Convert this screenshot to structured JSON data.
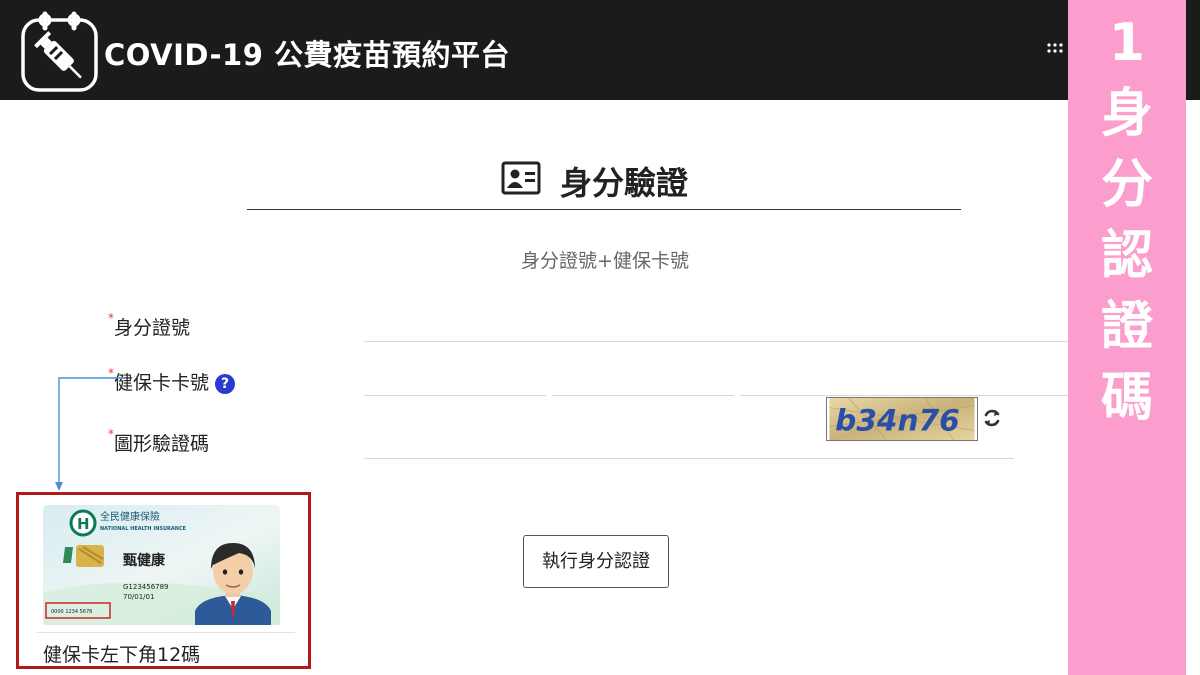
{
  "app": {
    "title": "COVID-19 公費疫苗預約平台",
    "logo_icon": "vaccine-syringe-icon",
    "menu_icon": "grid-dots-icon"
  },
  "banner": {
    "step_number": "1",
    "chars": [
      "身",
      "分",
      "認",
      "證",
      "碼"
    ],
    "color": "#fb9dcd"
  },
  "page": {
    "title": "身分驗證",
    "title_icon": "id-card-icon",
    "subtitle": "身分證號+健保卡號"
  },
  "form": {
    "required_mark": "*",
    "id_number": {
      "label": "身分證號",
      "value": ""
    },
    "nhi_card": {
      "label": "健保卡卡號",
      "help": "?",
      "values": [
        "",
        "",
        ""
      ]
    },
    "captcha": {
      "label": "圖形驗證碼",
      "value": "",
      "image_text": "b34n76",
      "refresh_icon": "refresh-icon"
    },
    "submit_label": "執行身分認證"
  },
  "hint": {
    "card": {
      "insurer_zh": "全民健康保險",
      "insurer_en": "NATIONAL HEALTH INSURANCE",
      "holder_name": "甄健康",
      "id_number": "G123456789",
      "birth_date": "70/01/01",
      "card_number": "0000 1234 5678"
    },
    "caption": "健保卡左下角12碼",
    "border_color": "#b01a1a"
  },
  "colors": {
    "header_bg": "#1b1b1b",
    "required": "#e53935",
    "help_badge": "#2a3bd0"
  }
}
